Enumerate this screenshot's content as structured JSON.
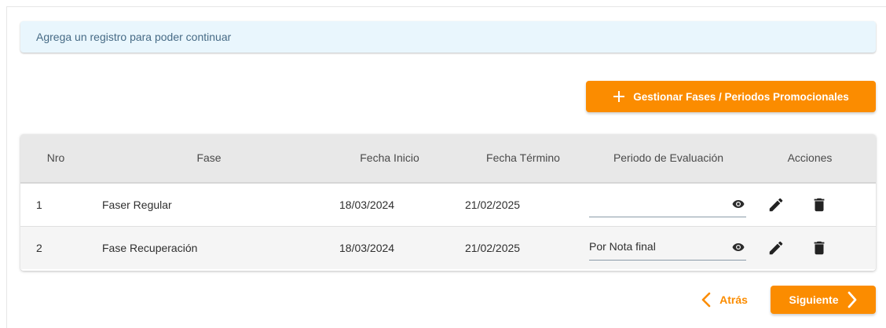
{
  "alert": {
    "message": "Agrega un registro para poder continuar"
  },
  "toolbar": {
    "manage_label": "Gestionar Fases / Periodos Promocionales"
  },
  "table": {
    "columns": [
      "Nro",
      "Fase",
      "Fecha Inicio",
      "Fecha Término",
      "Periodo de Evaluación",
      "Acciones"
    ],
    "rows": [
      {
        "nro": "1",
        "fase": "Faser Regular",
        "inicio": "18/03/2024",
        "fin": "21/02/2025",
        "periodo": ""
      },
      {
        "nro": "2",
        "fase": "Fase Recuperación",
        "inicio": "18/03/2024",
        "fin": "21/02/2025",
        "periodo": "Por Nota final"
      }
    ]
  },
  "footer": {
    "back_label": "Atrás",
    "next_label": "Siguiente"
  },
  "colors": {
    "accent": "#fb8c00",
    "alert_bg": "#e9f6fd",
    "alert_text": "#476b86",
    "header_bg": "#e8e8e8"
  },
  "icons": [
    "plus-icon",
    "eye-icon",
    "pencil-icon",
    "trash-icon",
    "chevron-left-icon",
    "chevron-right-icon"
  ]
}
